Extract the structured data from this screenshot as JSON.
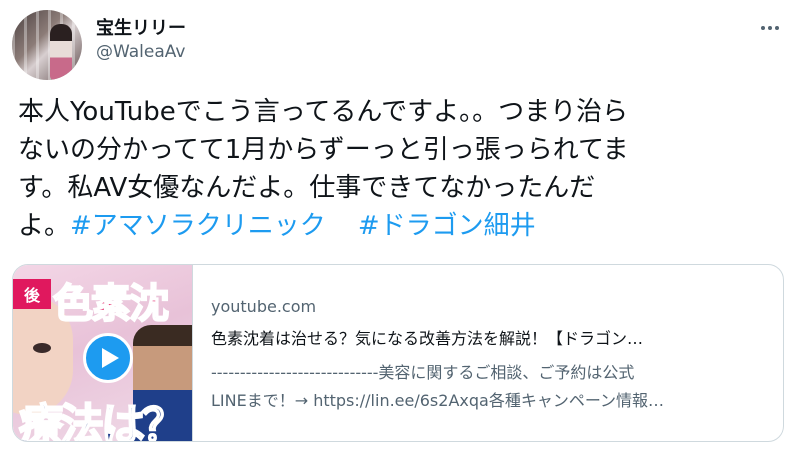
{
  "author": {
    "display_name": "宝生リリー",
    "handle": "@WaleaAv",
    "avatar_icon": "avatar-photo"
  },
  "menu": {
    "icon": "more-horizontal-icon"
  },
  "tweet": {
    "line1": "本人YouTubeでこう言ってるんですよ。。つまり治ら",
    "line2": "ないの分かってて1月からずーっと引っ張っられてま",
    "line3": "す。私AV女優なんだよ。仕事できてなかったんだ",
    "line4_text": "よ。",
    "hashtags": [
      "#アマソラクリニック",
      "#ドラゴン細井"
    ],
    "hashtag_color": "#1d9bf0"
  },
  "link_card": {
    "domain": "youtube.com",
    "title": "色素沈着は治せる？気になる改善方法を解説！【ドラゴン…",
    "description_line1": "-----------------------------美容に関するご相談、ご予約は公式",
    "description_line2": "LINEまで！→ https://lin.ee/6s2Axqa各種キャンペーン情報…",
    "thumbnail": {
      "badge": "後",
      "heading": "色素沈",
      "caption": "療法は？",
      "play_icon": "play-icon"
    }
  }
}
